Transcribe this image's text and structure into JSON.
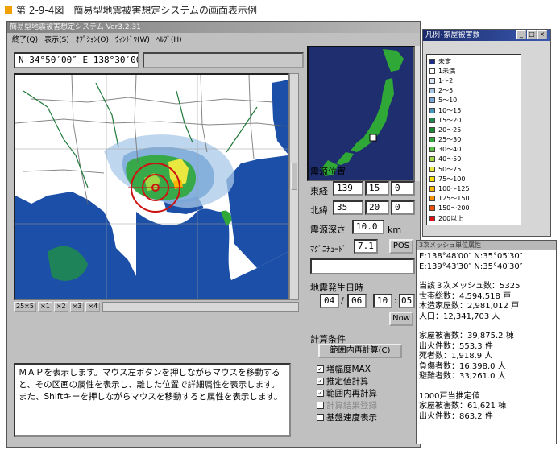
{
  "caption": {
    "text": "第 2-9-4図　簡易型地震被害想定システムの画面表示例"
  },
  "window": {
    "title": "簡易型地震被害想定システム  Ver3.2.31",
    "menu": [
      "終了(Q)",
      "表示(S)",
      "ｵﾌﾟｼｮﾝ(O)",
      "ｳｨﾝﾄﾞｳ(W)",
      "ﾍﾙﾌﾟ(H)"
    ]
  },
  "coord": {
    "text": "N 34°50′00″ E 138°30′00″"
  },
  "scale_buttons": [
    "25×5",
    "×1",
    "×2",
    "×3",
    "×4"
  ],
  "info_text": "ＭＡＰを表示します。マウス左ボタンを押しながらマウスを移動すると、その区画の属性を表示し、離した位置で詳細属性を表示します。また、Shiftキーを押しながらマウスを移動すると属性を表示します。",
  "epicenter": {
    "heading": "震源位置",
    "lon_label": "東経",
    "lon": [
      "139",
      "15",
      "0"
    ],
    "lat_label": "北緯",
    "lat": [
      "35",
      "20",
      "0"
    ],
    "depth_label": "震源深さ",
    "depth": "10.0",
    "depth_unit": "km",
    "mag_label": "ﾏｸﾞﾆﾁｭｰﾄﾞ",
    "mag": "7.1",
    "pos_button": "POS"
  },
  "datetime": {
    "heading": "地震発生日時",
    "month": "04",
    "day": "06",
    "hour": "10",
    "minute": "05",
    "sep": "/",
    "sep2": ":",
    "now_button": "Now"
  },
  "calc": {
    "heading": "計算条件",
    "recalc_button": "範囲内再計算(C)",
    "options": [
      {
        "label": "増幅度MAX",
        "checked": true,
        "disabled": false
      },
      {
        "label": "推定値計算",
        "checked": true,
        "disabled": false
      },
      {
        "label": "範囲内再計算",
        "checked": true,
        "disabled": false
      },
      {
        "label": "計算結果登録",
        "checked": false,
        "disabled": true
      },
      {
        "label": "基盤速度表示",
        "checked": false,
        "disabled": false
      }
    ]
  },
  "legend": {
    "title": "凡例･家屋被害数",
    "items": [
      {
        "label": "未定",
        "color": "#1a2c8c"
      },
      {
        "label": "1未満",
        "color": "#ffffff"
      },
      {
        "label": "1～2",
        "color": "#d8e8f8"
      },
      {
        "label": "2～5",
        "color": "#a8c8e8"
      },
      {
        "label": "5～10",
        "color": "#78a8d8"
      },
      {
        "label": "10～15",
        "color": "#4898c0"
      },
      {
        "label": "15～20",
        "color": "#208850"
      },
      {
        "label": "20～25",
        "color": "#188a30"
      },
      {
        "label": "25～30",
        "color": "#30a838"
      },
      {
        "label": "30～40",
        "color": "#58c040"
      },
      {
        "label": "40～50",
        "color": "#a0d848"
      },
      {
        "label": "50～75",
        "color": "#e8e840"
      },
      {
        "label": "75～100",
        "color": "#f8e000"
      },
      {
        "label": "100～125",
        "color": "#f8b800"
      },
      {
        "label": "125～150",
        "color": "#f89000"
      },
      {
        "label": "150～200",
        "color": "#f05000"
      },
      {
        "label": "200以上",
        "color": "#e01010"
      }
    ]
  },
  "mesh": {
    "title": "3次メッシュ単位属性",
    "lines": [
      "E:138°48′00″  N:35°05′30″",
      "E:139°43′30″  N:35°40′30″",
      "",
      "当該３次メッシュ数：5325",
      "世帯総数：4,594,518 戸",
      "木造家屋数：2,981,012 戸",
      "人口：12,341,703 人",
      "",
      "家屋被害数：39,875.2 棟",
      "出火件数：553.3 件",
      "死者数：1,918.9 人",
      "負傷者数：16,398.0 人",
      "避難者数：33,261.0 人",
      "",
      "1000戸当推定値",
      "家屋被害数：61,621 棟",
      "出火件数：863.2 件"
    ]
  }
}
